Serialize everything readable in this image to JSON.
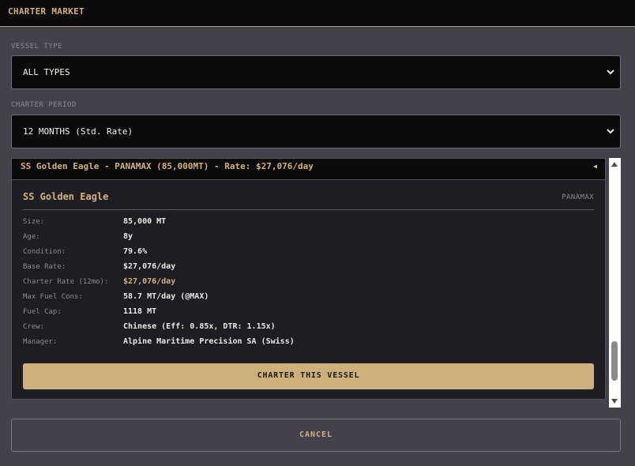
{
  "window": {
    "title": "CHARTER MARKET"
  },
  "vessel_type": {
    "label": "VESSEL TYPE",
    "selected": "ALL TYPES"
  },
  "charter_period": {
    "label": "CHARTER PERIOD",
    "selected": "12 MONTHS (Std. Rate)"
  },
  "listing": {
    "selected_option": "SS Golden Eagle - PANAMAX (85,000MT) - Rate: $27,076/day",
    "vessel_name": "SS Golden Eagle",
    "vessel_class": "PANAMAX",
    "specs": [
      {
        "key": "Size:",
        "value": "85,000 MT",
        "highlight": false
      },
      {
        "key": "Age:",
        "value": "8y",
        "highlight": false
      },
      {
        "key": "Condition:",
        "value": "79.6%",
        "highlight": false
      },
      {
        "key": "Base Rate:",
        "value": "$27,076/day",
        "highlight": false
      },
      {
        "key": "Charter Rate (12mo):",
        "value": "$27,076/day",
        "highlight": true
      },
      {
        "key": "Max Fuel Cons:",
        "value": "58.7 MT/day (@MAX)",
        "highlight": false
      },
      {
        "key": "Fuel Cap:",
        "value": "1118 MT",
        "highlight": false
      },
      {
        "key": "Crew:",
        "value": "Chinese (Eff: 0.85x, DTR: 1.15x)",
        "highlight": false
      },
      {
        "key": "Manager:",
        "value": "Alpine Maritime Precision SA (Swiss)",
        "highlight": false
      }
    ],
    "charter_button": "CHARTER THIS VESSEL"
  },
  "actions": {
    "cancel": "CANCEL"
  },
  "colors": {
    "accent": "#d1b27e",
    "button_fill": "#cdb07c",
    "background": "#43414c",
    "panel": "#1e1d24"
  },
  "icons": {
    "select_chevron": "chevron-down-icon",
    "option_marker": "caret-left-icon"
  }
}
